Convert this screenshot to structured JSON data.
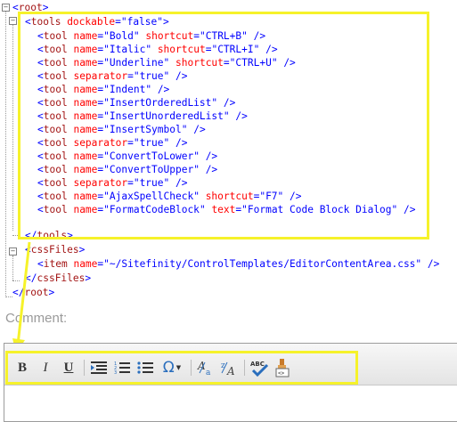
{
  "xml": {
    "root_open": "root",
    "tools_tag": "tools",
    "tools_attr": "dockable",
    "tools_val": "false",
    "tool_tag": "tool",
    "tools_close": "tools",
    "cssfiles_tag": "cssFiles",
    "item_tag": "item",
    "item_attr": "name",
    "item_val": "~/Sitefinity/ControlTemplates/EditorContentArea.css",
    "cssfiles_close": "cssFiles",
    "root_close": "root",
    "tools": [
      {
        "a1": "name",
        "v1": "Bold",
        "a2": "shortcut",
        "v2": "CTRL+B",
        "end": "/>"
      },
      {
        "a1": "name",
        "v1": "Italic",
        "a2": "shortcut",
        "v2": "CTRL+I",
        "end": "/>"
      },
      {
        "a1": "name",
        "v1": "Underline",
        "a2": "shortcut",
        "v2": "CTRL+U",
        "end": "/>"
      },
      {
        "a1": "separator",
        "v1": "true",
        "a2": "",
        "v2": "",
        "end": "/>"
      },
      {
        "a1": "name",
        "v1": "Indent",
        "a2": "",
        "v2": "",
        "end": "/>"
      },
      {
        "a1": "name",
        "v1": "InsertOrderedList",
        "a2": "",
        "v2": "",
        "end": "/>"
      },
      {
        "a1": "name",
        "v1": "InsertUnorderedList",
        "a2": "",
        "v2": "",
        "end": "/>"
      },
      {
        "a1": "name",
        "v1": "InsertSymbol",
        "a2": "",
        "v2": "",
        "end": "/>"
      },
      {
        "a1": "separator",
        "v1": "true",
        "a2": "",
        "v2": "",
        "end": "/>"
      },
      {
        "a1": "name",
        "v1": "ConvertToLower",
        "a2": "",
        "v2": "",
        "end": "/>"
      },
      {
        "a1": "name",
        "v1": "ConvertToUpper",
        "a2": "",
        "v2": "",
        "end": "/>"
      },
      {
        "a1": "separator",
        "v1": "true",
        "a2": "",
        "v2": "",
        "end": "/>"
      },
      {
        "a1": "name",
        "v1": "AjaxSpellCheck",
        "a2": "shortcut",
        "v2": "F7",
        "end": "/>"
      },
      {
        "a1": "name",
        "v1": "FormatCodeBlock",
        "a2": "text",
        "v2": "Format Code Block Dialog",
        "end": "/>"
      }
    ]
  },
  "comment_label": "Comment:",
  "toolbar": {
    "bold": "B",
    "italic": "I",
    "underline": "U",
    "symbol": "Ω",
    "icons": [
      "bold-icon",
      "italic-icon",
      "underline-icon",
      "indent-icon",
      "ordered-list-icon",
      "unordered-list-icon",
      "insert-symbol-icon",
      "convert-lower-icon",
      "convert-upper-icon",
      "spellcheck-icon",
      "format-code-block-icon"
    ]
  },
  "colors": {
    "highlight": "#f6f22a",
    "xml_tag": "#a31515",
    "xml_attr": "#ff0000",
    "xml_value": "#0000ff"
  }
}
